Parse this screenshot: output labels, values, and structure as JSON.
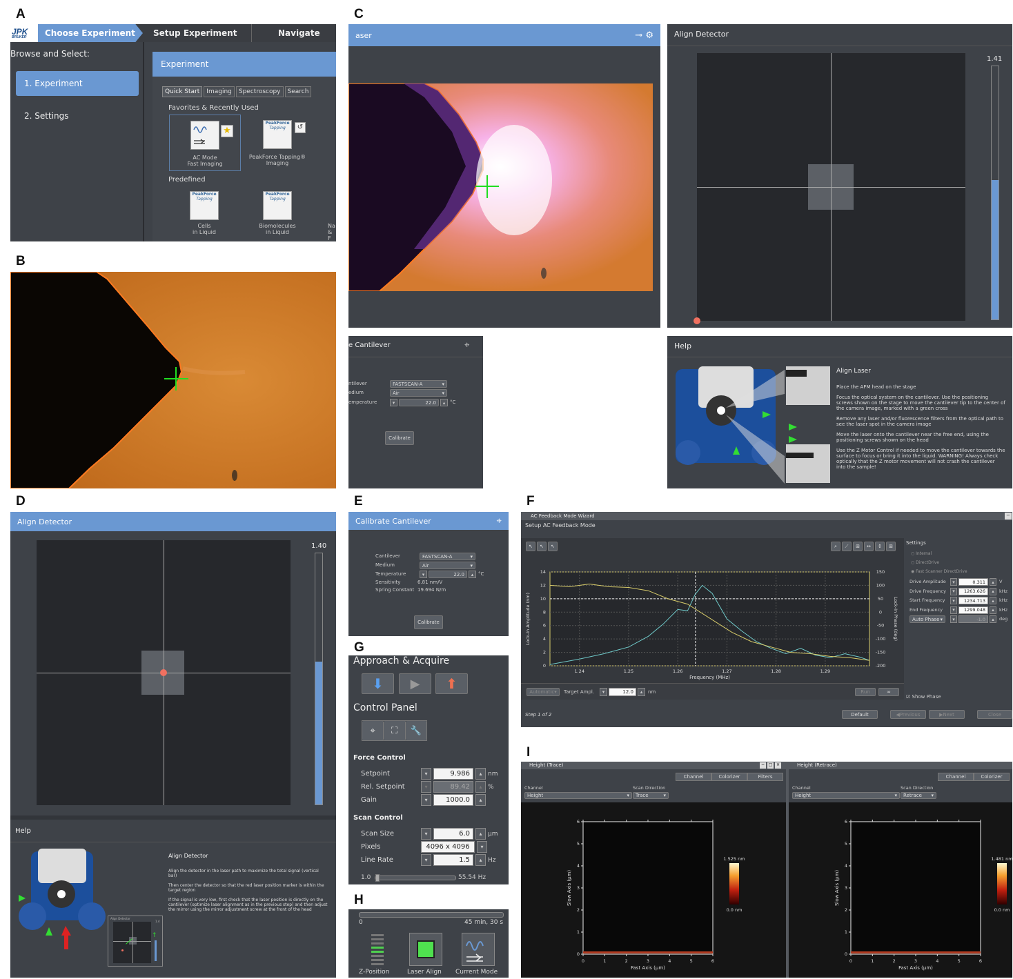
{
  "panel_labels": {
    "a": "A",
    "b": "B",
    "c": "C",
    "d": "D",
    "e": "E",
    "f": "F",
    "g": "G",
    "h": "H",
    "i": "I"
  },
  "panel_a": {
    "logo": "JPK",
    "logo_sub": "BRUKER",
    "steps": [
      "Choose Experiment",
      "Setup Experiment",
      "Navigate"
    ],
    "browse_label": "Browse and Select:",
    "sidebar": [
      "1. Experiment",
      "2. Settings"
    ],
    "experiment_title": "Experiment",
    "tabs": [
      "Quick Start",
      "Imaging",
      "Spectroscopy",
      "Search"
    ],
    "favorites_title": "Favorites & Recently Used",
    "favorites": [
      {
        "line1": "AC Mode",
        "line2": "Fast Imaging"
      },
      {
        "line1": "PeakForce Tapping®",
        "line2": "Imaging",
        "tile": "PeakForce",
        "tile_sub": "Tapping"
      }
    ],
    "predefined_title": "Predefined",
    "predefined": [
      {
        "line1": "Cells",
        "line2": "in Liquid",
        "tile": "PeakForce",
        "tile_sub": "Tapping"
      },
      {
        "line1": "Biomolecules",
        "line2": "in Liquid",
        "tile": "PeakForce",
        "tile_sub": "Tapping"
      },
      {
        "line1": "Na",
        "line2": "& F"
      }
    ]
  },
  "panel_c": {
    "laser_title": "aser",
    "align_title": "Align Detector",
    "align_value": "1.41",
    "align_fill": 0.55,
    "cal_title": "e Cantilever",
    "cal_labels": [
      "ntilever",
      "edium",
      "emperature"
    ],
    "cal_cantilever": "FASTSCAN-A",
    "cal_medium": "Air",
    "cal_temperature": "22.0",
    "cal_temp_unit": "°C",
    "calibrate": "Calibrate",
    "help_title": "Help",
    "help_heading": "Align Laser",
    "help_lines": [
      "Place the AFM head on the stage",
      "Focus the optical system on the cantilever. Use the positioning screws shown on the stage to move the cantilever tip to the center of the camera image, marked with a green cross",
      "Remove any laser and/or fluorescence filters from the optical path to see the laser spot in the camera image",
      "Move the laser onto the cantilever near the free end, using the positioning screws shown on the head",
      "Use the Z Motor Control if needed to move the cantilever towards the surface to focus or bring it into the liquid. WARNING! Always check optically that the Z motor movement will not crash the cantilever into the sample!"
    ]
  },
  "panel_d": {
    "title": "Align Detector",
    "value": "1.40",
    "fill": 0.57,
    "help_title": "Help",
    "help_heading": "Align Detector",
    "help_lines": [
      "Align the detector in the laser path to maximize the total signal (vertical bar)",
      "Then center the detector so that the red laser position marker is within the target region",
      "If the signal is very low, first check that the laser position is directly on the cantilever (optimize laser alignment as in the previous step) and then adjust the mirror using the mirror adjustment screw at the front of the head"
    ],
    "mini_title": "Align Detector",
    "mini_value": "1.4"
  },
  "panel_e": {
    "title": "Calibrate Cantilever",
    "labels": [
      "Cantilever",
      "Medium",
      "Temperature",
      "Sensitivity",
      "Spring Constant"
    ],
    "cantilever": "FASTSCAN-A",
    "medium": "Air",
    "temperature": "22.0",
    "temp_unit": "°C",
    "sensitivity": "6.81 nm/V",
    "spring_constant": "19.694 N/m",
    "calibrate": "Calibrate"
  },
  "panel_f": {
    "window_title": "AC Feedback Mode Wizard",
    "subtitle": "Setup AC Feedback Mode",
    "settings_title": "Settings",
    "radios": [
      "Internal",
      "DirectDrive",
      "Fast Scanner DirectDrive"
    ],
    "params": [
      {
        "label": "Drive Amplitude",
        "value": "0.311",
        "unit": "V"
      },
      {
        "label": "Drive Frequency",
        "value": "1263.626",
        "unit": "kHz"
      },
      {
        "label": "Start Frequency",
        "value": "1234.713",
        "unit": "kHz"
      },
      {
        "label": "End Frequency",
        "value": "1299.048",
        "unit": "kHz"
      },
      {
        "label": "Auto Phase",
        "value": "-1.0",
        "unit": "deg"
      }
    ],
    "automatic": "Automatic",
    "target_label": "Target Ampl.",
    "target_value": "12.0",
    "target_unit": "nm",
    "run": "Run",
    "infinity": "∞",
    "show_phase": "Show Phase",
    "step": "Step 1 of 2",
    "buttons": [
      "Default",
      "Previous",
      "Next",
      "Close"
    ]
  },
  "panel_g": {
    "approach_title": "Approach & Acquire",
    "control_title": "Control Panel",
    "force_title": "Force Control",
    "force": [
      {
        "label": "Setpoint",
        "value": "9.986",
        "unit": "nm"
      },
      {
        "label": "Rel. Setpoint",
        "value": "89.42",
        "unit": "%"
      },
      {
        "label": "Gain",
        "value": "1000.0",
        "unit": ""
      }
    ],
    "scan_title": "Scan Control",
    "scan": [
      {
        "label": "Scan Size",
        "value": "6.0",
        "unit": "µm"
      },
      {
        "label": "Pixels",
        "value": "4096 x 4096",
        "unit": ""
      },
      {
        "label": "Line Rate",
        "value": "1.5",
        "unit": "Hz"
      }
    ],
    "slider_min": "1.0",
    "slider_max": "55.54 Hz"
  },
  "panel_h": {
    "progress_start": "0",
    "progress_end": "45 min, 30 s",
    "items": [
      "Z-Position",
      "Laser Align",
      "Current Mode"
    ]
  },
  "panel_i": {
    "windows": [
      {
        "title": "Height (Trace)",
        "tabs": [
          "Channel",
          "Colorizer",
          "Filters"
        ],
        "channel": "Height",
        "direction": "Trace",
        "max": "1.525 nm",
        "min": "0.0 nm"
      },
      {
        "title": "Height (Retrace)",
        "tabs": [
          "Channel",
          "Colorizer"
        ],
        "channel": "Height",
        "direction": "Retrace",
        "max": "1.481 nm",
        "min": "0.0 nm"
      }
    ],
    "channel_label": "Channel",
    "direction_label": "Scan Direction",
    "xlabel": "Fast Axis (µm)",
    "ylabel": "Slow Axis (µm)",
    "ticks": [
      "0",
      "1",
      "2",
      "3",
      "4",
      "5",
      "6"
    ]
  },
  "chart_data": {
    "type": "line",
    "xlabel": "Frequency (MHz)",
    "ylabel": "Lock-In Amplitude (nm)",
    "y2label": "Lock-In Phase (deg)",
    "xlim": [
      1.234,
      1.299
    ],
    "ylim": [
      0,
      14
    ],
    "y2lim": [
      -200,
      150
    ],
    "xticks": [
      "1.24",
      "1.25",
      "1.26",
      "1.27",
      "1.28",
      "1.29"
    ],
    "yticks": [
      "0",
      "2",
      "4",
      "6",
      "8",
      "10",
      "12",
      "14"
    ],
    "y2ticks": [
      "-200",
      "-150",
      "-100",
      "-50",
      "0",
      "50",
      "100",
      "150"
    ],
    "grid": true,
    "marker_x": 1.2636,
    "setpoint_y": 10,
    "series": [
      {
        "axis": "left",
        "color": "#6fc9c9",
        "x": [
          1.234,
          1.24,
          1.245,
          1.25,
          1.254,
          1.257,
          1.26,
          1.262,
          1.2635,
          1.265,
          1.267,
          1.27,
          1.273,
          1.276,
          1.279,
          1.282,
          1.285,
          1.288,
          1.291,
          1.294,
          1.297,
          1.299
        ],
        "values": [
          0.2,
          1.0,
          1.8,
          2.8,
          4.4,
          6.2,
          8.4,
          8.2,
          10.6,
          12.0,
          10.8,
          7.0,
          5.2,
          3.6,
          2.6,
          1.8,
          2.6,
          1.6,
          1.2,
          1.8,
          1.3,
          0.8
        ]
      },
      {
        "axis": "right",
        "color": "#d8cc6a",
        "x": [
          1.234,
          1.238,
          1.242,
          1.246,
          1.25,
          1.254,
          1.258,
          1.262,
          1.265,
          1.268,
          1.271,
          1.275,
          1.279,
          1.283,
          1.287,
          1.291,
          1.295,
          1.299
        ],
        "values": [
          100,
          95,
          105,
          95,
          92,
          80,
          50,
          30,
          -5,
          -40,
          -75,
          -110,
          -130,
          -150,
          -155,
          -165,
          -170,
          -180
        ]
      }
    ]
  }
}
